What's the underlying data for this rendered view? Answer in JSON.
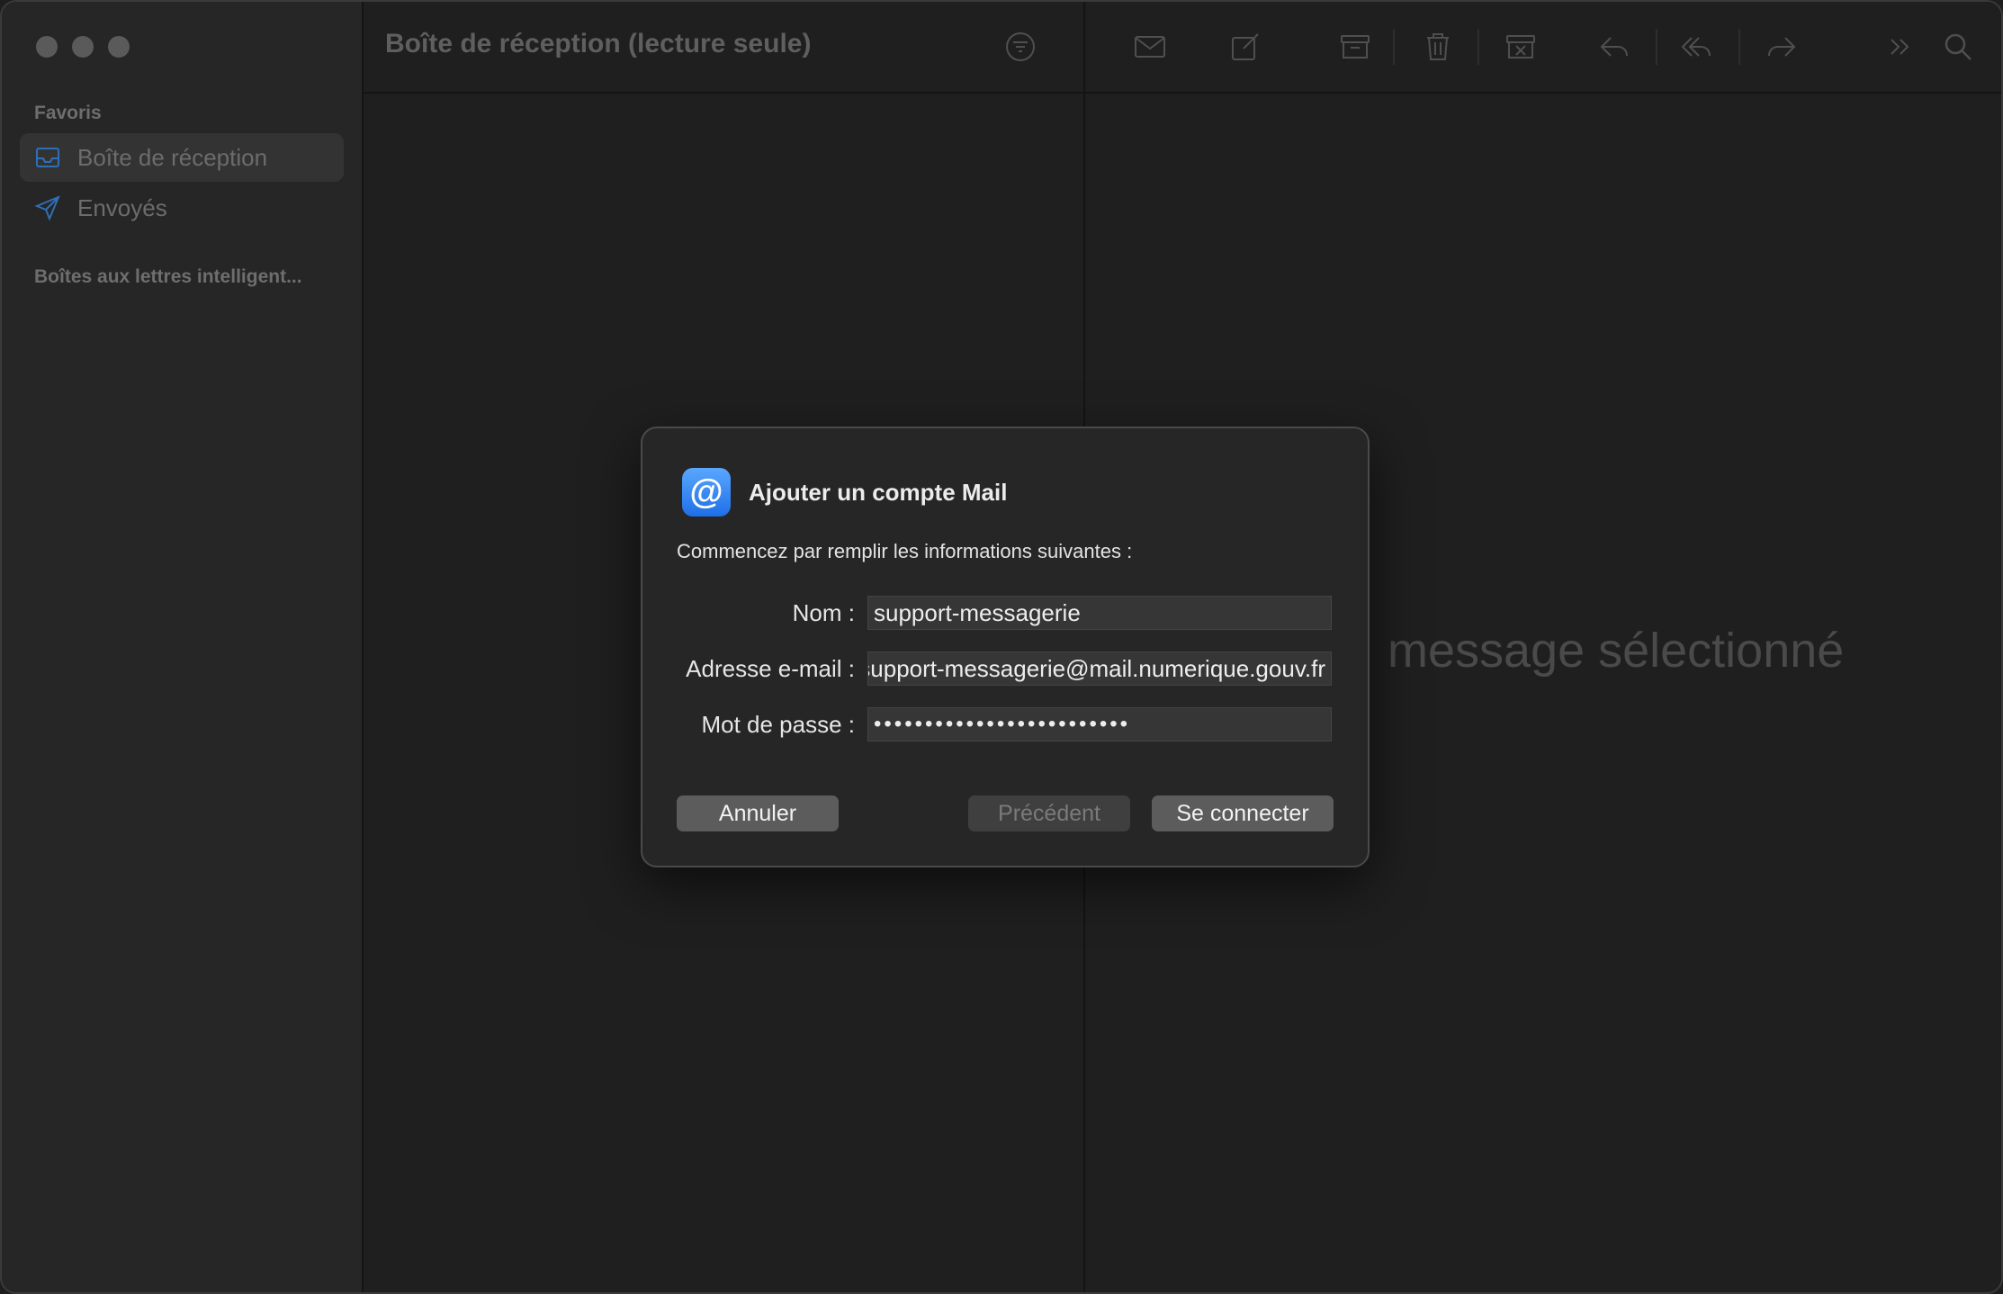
{
  "sidebar": {
    "favorites_label": "Favoris",
    "items": [
      {
        "label": "Boîte de réception",
        "icon": "inbox-icon",
        "selected": true
      },
      {
        "label": "Envoyés",
        "icon": "paper-plane-icon",
        "selected": false
      }
    ],
    "smart_mailboxes_label": "Boîtes aux lettres intelligent..."
  },
  "list": {
    "title": "Boîte de réception (lecture seule)"
  },
  "toolbar": {
    "icons": [
      "envelope-icon",
      "compose-icon",
      "archive-icon",
      "trash-icon",
      "junk-icon",
      "reply-icon",
      "reply-all-icon",
      "forward-icon",
      "more-icon",
      "search-icon"
    ]
  },
  "message_pane": {
    "placeholder": "message sélectionné"
  },
  "dialog": {
    "title": "Ajouter un compte Mail",
    "subtitle": "Commencez par remplir les informations suivantes :",
    "fields": {
      "name_label": "Nom :",
      "name_value": "support-messagerie",
      "email_label": "Adresse e-mail :",
      "email_value": "support-messagerie@mail.numerique.gouv.fr",
      "password_label": "Mot de passe :",
      "password_value": "•••••••••••••••••••••••••"
    },
    "buttons": {
      "cancel": "Annuler",
      "previous": "Précédent",
      "connect": "Se connecter"
    }
  },
  "colors": {
    "accent": "#2f80ed",
    "window_bg": "#1f1f1f",
    "sidebar_bg": "#262626"
  }
}
